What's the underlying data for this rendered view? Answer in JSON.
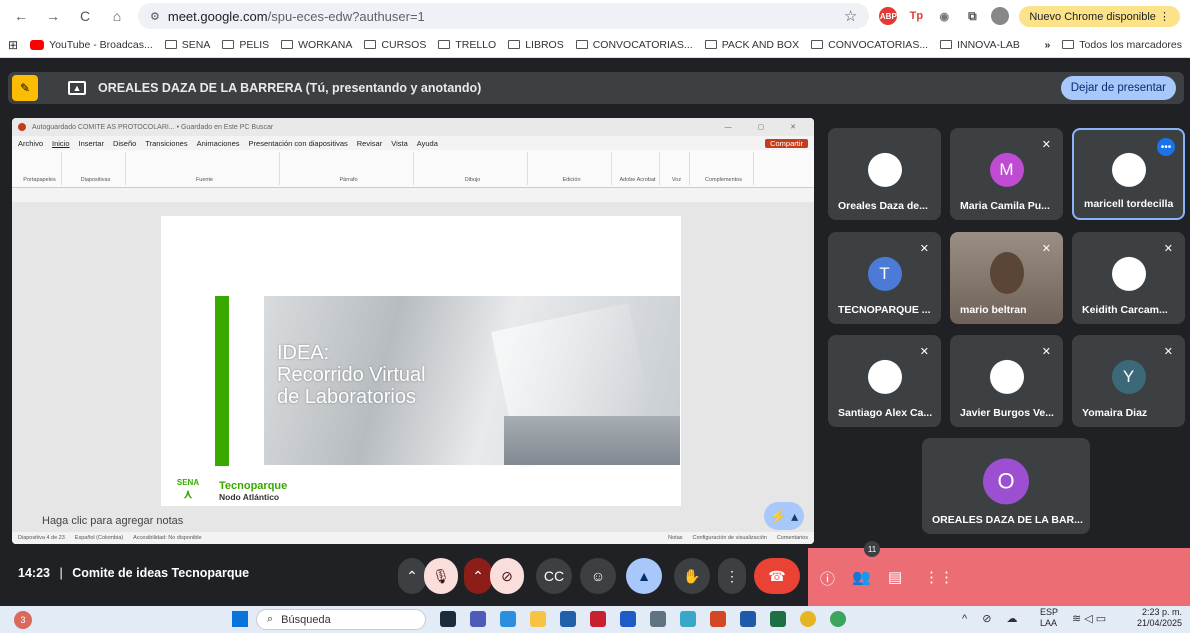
{
  "browser": {
    "url_host": "meet.google.com",
    "url_path": "/spu-eces-edw?authuser=1",
    "update_label": "Nuevo Chrome disponible"
  },
  "bookmarks": [
    "YouTube - Broadcas...",
    "SENA",
    "PELIS",
    "WORKANA",
    "CURSOS",
    "TRELLO",
    "LIBROS",
    "CONVOCATORIAS...",
    "PACK AND BOX",
    "CONVOCATORIAS...",
    "INNOVA-LAB"
  ],
  "bookmarks_more": "»",
  "all_bookmarks": "Todos los marcadores",
  "presenting": {
    "label": "OREALES DAZA DE LA BARRERA (Tú, presentando y anotando)",
    "stop_button": "Dejar de presentar"
  },
  "ppt": {
    "titlebar": "Autoguardado   COMITE AS PROTOCOLARI... • Guardado en Este PC   Buscar",
    "menu": [
      "Archivo",
      "Inicio",
      "Insertar",
      "Diseño",
      "Transiciones",
      "Animaciones",
      "Presentación con diapositivas",
      "Revisar",
      "Vista",
      "Ayuda"
    ],
    "share": "Compartir",
    "ribbon_groups": [
      "Portapapeles",
      "Diapositivas",
      "Fuente",
      "Párrafo",
      "Dibujo",
      "Edición",
      "Adobe Acrobat",
      "Voz",
      "Complementos"
    ],
    "slide_title_1": "IDEA:",
    "slide_title_2": "Recorrido Virtual",
    "slide_title_3": "de Laboratorios",
    "logo_text": "SENA",
    "brand": "Tecnoparque",
    "brand_sub": "Nodo Atlántico",
    "notes_placeholder": "Haga clic para agregar notas",
    "status_slide": "Diapositiva 4 de 23",
    "status_lang": "Español (Colombia)",
    "status_access": "Accesibilidad: No disponible",
    "status_notes": "Notas",
    "status_view": "Configuración de visualización",
    "status_comments": "Comentarios"
  },
  "participants": [
    {
      "name": "Oreales Daza de...",
      "color": "#ffffff",
      "initial": ""
    },
    {
      "name": "Maria Camila Pu...",
      "color": "#c04bd3",
      "initial": "M"
    },
    {
      "name": "maricell tordecilla",
      "color": "#ffffff",
      "initial": ""
    },
    {
      "name": "TECNOPARQUE ...",
      "color": "#4b7bd6",
      "initial": "T"
    },
    {
      "name": "mario beltran",
      "color": "#7a6b5e",
      "initial": ""
    },
    {
      "name": "Keidith Carcam...",
      "color": "#ffffff",
      "initial": ""
    },
    {
      "name": "Santiago Alex Ca...",
      "color": "#ffffff",
      "initial": ""
    },
    {
      "name": "Javier Burgos Ve...",
      "color": "#ffffff",
      "initial": ""
    },
    {
      "name": "Yomaira Diaz",
      "color": "#3b6978",
      "initial": "Y"
    },
    {
      "name": "OREALES DAZA DE LA BAR...",
      "color": "#9c4fd1",
      "initial": "O"
    }
  ],
  "meeting": {
    "time": "14:23",
    "separator": "|",
    "title": "Comite de ideas Tecnoparque",
    "people_count": "11"
  },
  "taskbar": {
    "search": "Búsqueda",
    "notif_count": "3",
    "lang_1": "ESP",
    "lang_2": "LAA",
    "time": "2:23 p. m.",
    "date": "21/04/2025"
  }
}
